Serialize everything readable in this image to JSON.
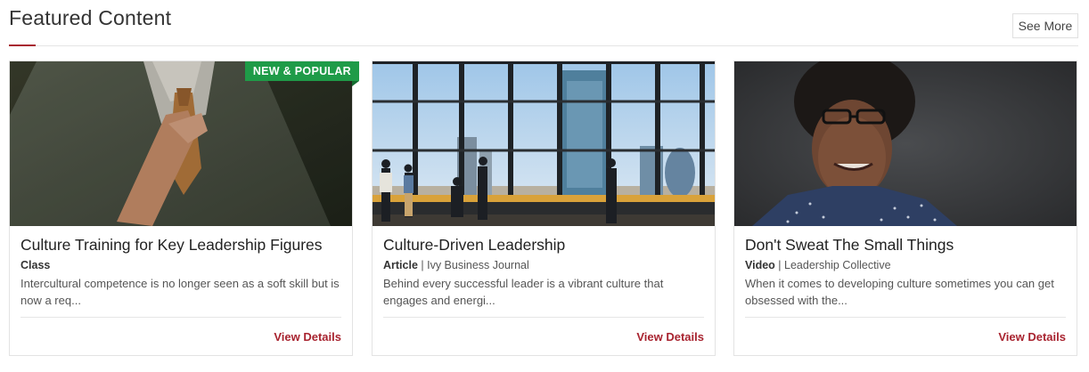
{
  "header": {
    "title": "Featured Content",
    "see_more_label": "See More"
  },
  "colors": {
    "accent": "#a8232f",
    "badge_green": "#1f9b48"
  },
  "cards": [
    {
      "badge": "NEW & POPULAR",
      "title": "Culture Training for Key Leadership Figures",
      "type": "Class",
      "source": "",
      "description": "Intercultural competence is no longer seen as a soft skill but is now a req...",
      "link_label": "View Details",
      "image": "man-adjusting-tie-photo"
    },
    {
      "title": "Culture-Driven Leadership",
      "type": "Article",
      "separator": " | ",
      "source": "Ivy Business Journal",
      "description": "Behind every successful leader is a vibrant culture that engages and energi...",
      "link_label": "View Details",
      "image": "office-window-skyline-photo"
    },
    {
      "title": "Don't Sweat The Small Things",
      "type": "Video",
      "separator": " | ",
      "source": "Leadership Collective",
      "description": "When it comes to developing culture sometimes you can get obsessed with the...",
      "link_label": "View Details",
      "image": "smiling-woman-glasses-photo"
    }
  ]
}
